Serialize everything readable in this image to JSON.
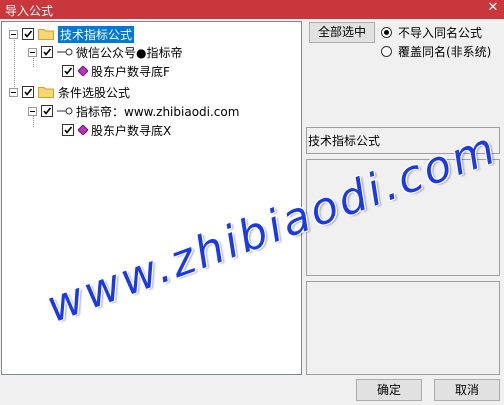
{
  "window": {
    "title": "导入公式",
    "close_glyph": "✕"
  },
  "tree": {
    "nodes": [
      {
        "label": "技术指标公式",
        "checked": true,
        "selected": true
      },
      {
        "label": "微信公众号●指标帝",
        "checked": true
      },
      {
        "label": "股东户数寻底F",
        "checked": true
      },
      {
        "label": "条件选股公式",
        "checked": true
      },
      {
        "label": "指标帝：www.zhibiaodi.com",
        "checked": true
      },
      {
        "label": "股东户数寻底X",
        "checked": true
      }
    ]
  },
  "right": {
    "select_all_label": "全部选中",
    "radio_options": [
      {
        "label": "不导入同名公式",
        "selected": true
      },
      {
        "label": "覆盖同名(非系统)",
        "selected": false
      }
    ],
    "formula_type_label": "技术指标公式"
  },
  "buttons": {
    "ok": "确定",
    "cancel": "取消"
  },
  "watermark": "www.zhibiaodi.com",
  "colors": {
    "titlebar": "#c7373b",
    "selection": "#0078d7",
    "watermark": "#1a39e8"
  }
}
